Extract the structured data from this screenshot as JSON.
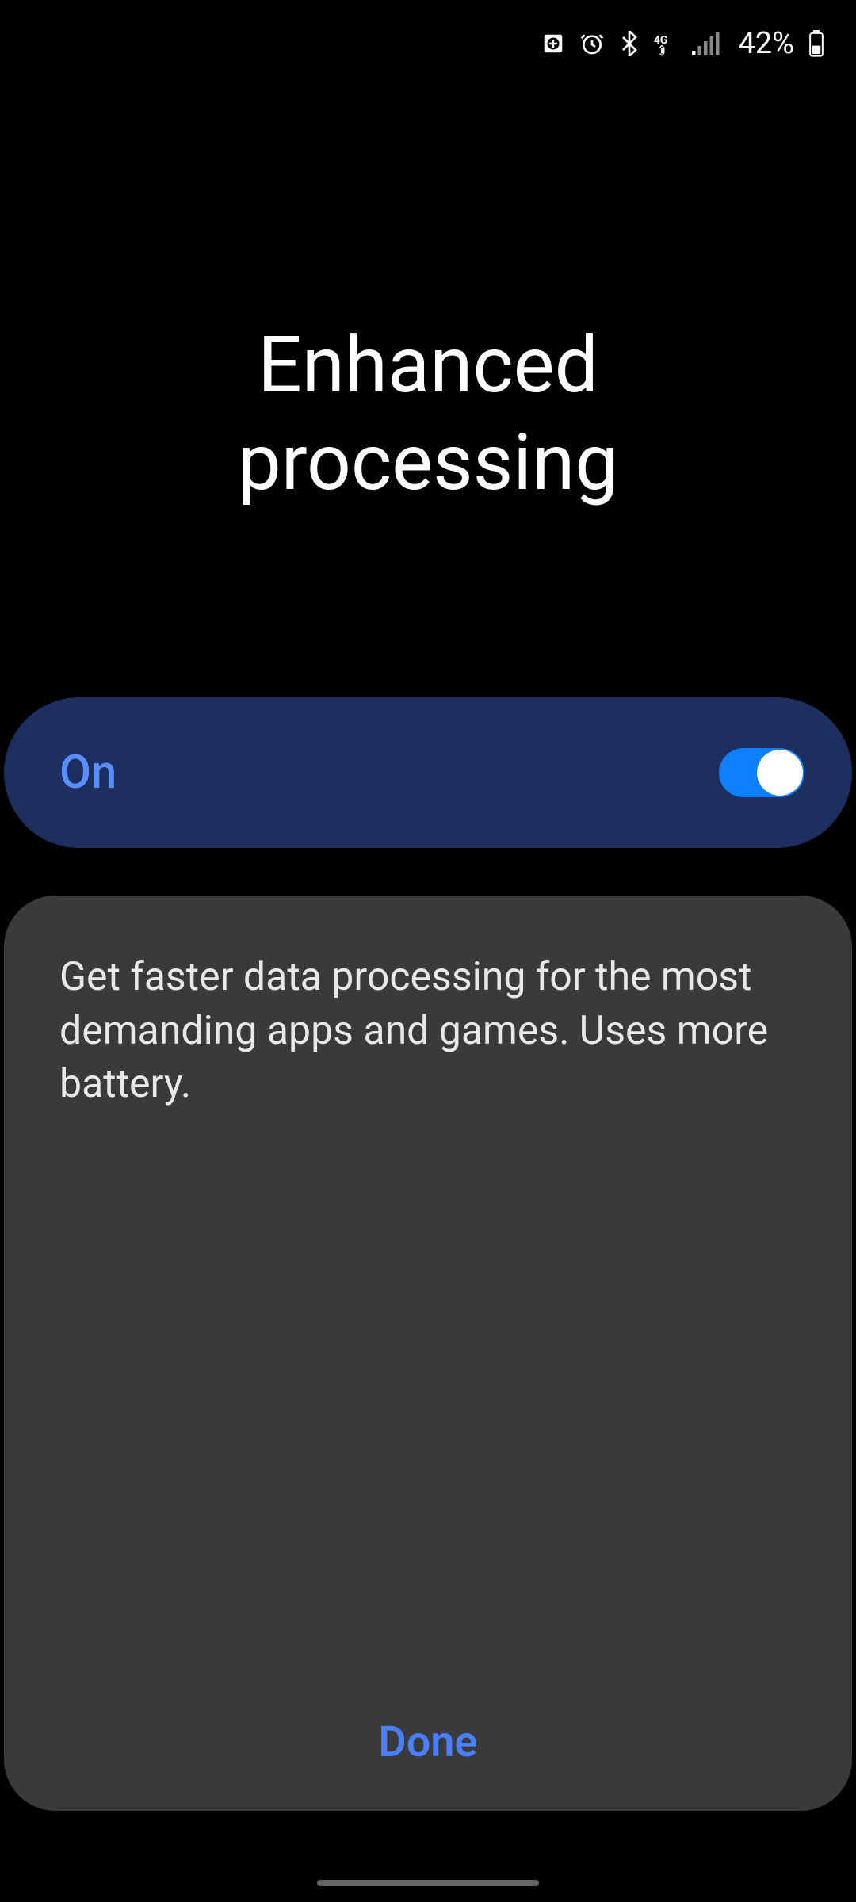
{
  "status_bar": {
    "battery_percent": "42%"
  },
  "title": "Enhanced\nprocessing",
  "toggle": {
    "label": "On",
    "enabled": true
  },
  "description": "Get faster data processing for the most demanding apps and games. Uses more battery.",
  "done_button_label": "Done"
}
